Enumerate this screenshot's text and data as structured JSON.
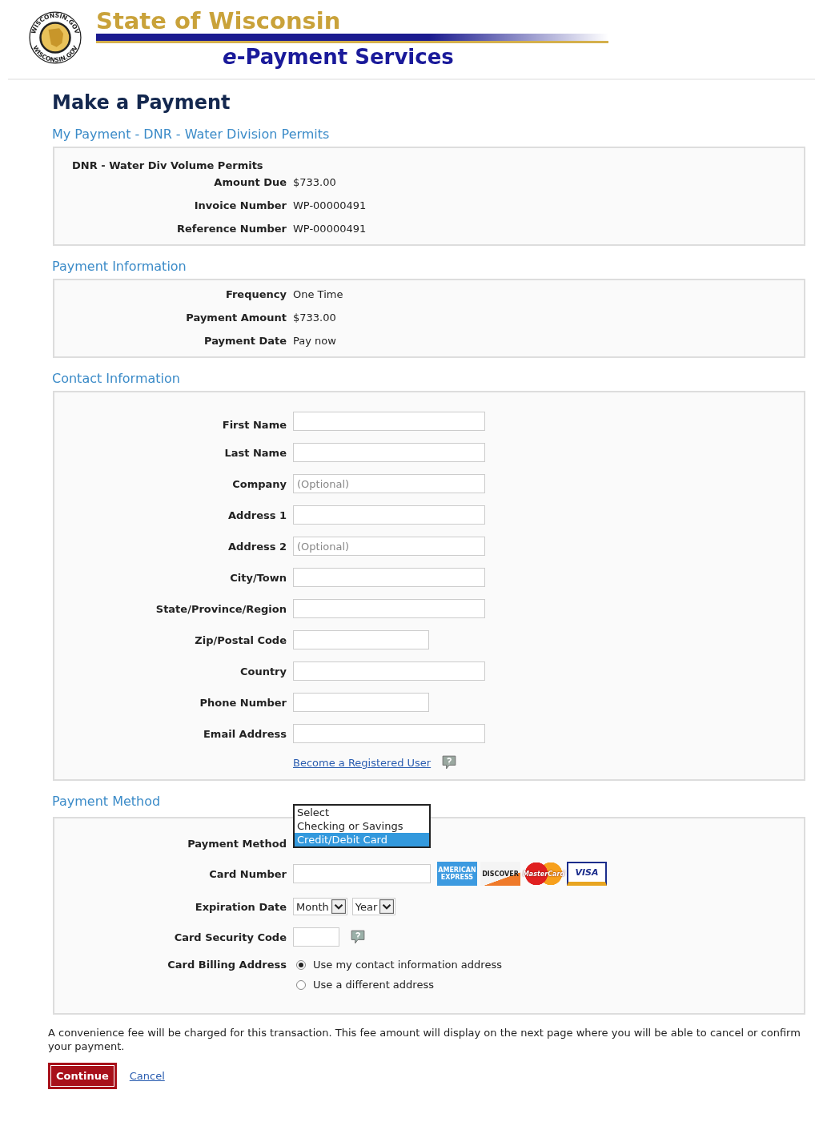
{
  "header": {
    "seal_text": [
      "WISCONSIN.GOV",
      "WISCONSIN.GOV"
    ],
    "title": "State of Wisconsin",
    "subtitle_prefix": "e",
    "subtitle": "-Payment Services"
  },
  "page_title": "Make a Payment",
  "my_payment": {
    "heading": "My Payment - DNR - Water Division Permits",
    "item_title": "DNR - Water Div Volume Permits",
    "fields": [
      {
        "label": "Amount Due",
        "value": "$733.00"
      },
      {
        "label": "Invoice Number",
        "value": "WP-00000491"
      },
      {
        "label": "Reference Number",
        "value": "WP-00000491"
      }
    ]
  },
  "payment_information": {
    "heading": "Payment Information",
    "fields": [
      {
        "label": "Frequency",
        "value": "One Time"
      },
      {
        "label": "Payment Amount",
        "value": "$733.00"
      },
      {
        "label": "Payment Date",
        "value": "Pay now"
      }
    ]
  },
  "contact_information": {
    "heading": "Contact Information",
    "fields": [
      {
        "label": "First Name",
        "kind": "long"
      },
      {
        "label": "Last Name",
        "kind": "long"
      },
      {
        "label": "Company",
        "kind": "long",
        "placeholder": "(Optional)"
      },
      {
        "label": "Address 1",
        "kind": "long"
      },
      {
        "label": "Address 2",
        "kind": "long",
        "placeholder": "(Optional)"
      },
      {
        "label": "City/Town",
        "kind": "long"
      },
      {
        "label": "State/Province/Region",
        "kind": "long"
      },
      {
        "label": "Zip/Postal Code",
        "kind": "medium"
      },
      {
        "label": "Country",
        "kind": "long"
      },
      {
        "label": "Phone Number",
        "kind": "medium"
      },
      {
        "label": "Email Address",
        "kind": "long"
      }
    ],
    "link": "Become a Registered User"
  },
  "payment_method": {
    "heading": "Payment Method",
    "method_label": "Payment Method",
    "options": [
      {
        "label": "Select",
        "selected": false
      },
      {
        "label": "Checking or Savings",
        "selected": false
      },
      {
        "label": "Credit/Debit Card",
        "selected": true
      }
    ],
    "card_number_label": "Card Number",
    "cards": [
      {
        "kind": "amex",
        "label": "AMERICAN EXPRESS"
      },
      {
        "kind": "discover",
        "label": "DISCOVER"
      },
      {
        "kind": "mastercard",
        "label": "MasterCard"
      },
      {
        "kind": "visa",
        "label": "VISA"
      }
    ],
    "expiration_label": "Expiration Date",
    "month": "Month",
    "year": "Year",
    "security_label": "Card Security Code",
    "billing_label": "Card Billing Address",
    "billing_options": [
      {
        "label": "Use my contact information address",
        "selected": true
      },
      {
        "label": "Use a different address",
        "selected": false
      }
    ]
  },
  "notice": "A convenience fee will be charged for this transaction. This fee amount will display on the next page where you will be able to cancel or confirm your payment.",
  "continue": "Continue",
  "cancel": "Cancel"
}
